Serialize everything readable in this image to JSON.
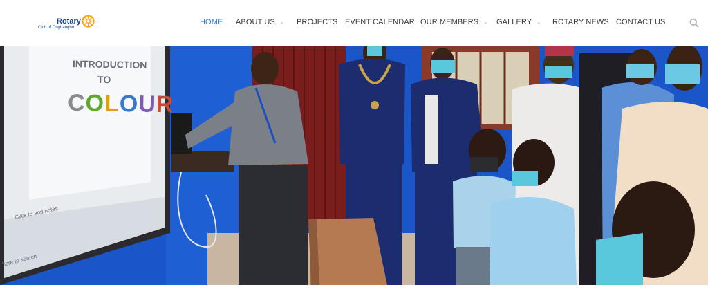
{
  "logo": {
    "word": "Rotary",
    "club": "Club of Ongbangbo",
    "icon": "rotary-wheel-icon",
    "color": "#17458f",
    "wheel_color": "#f7a81b"
  },
  "nav": {
    "items": [
      {
        "label": "HOME",
        "active": true
      },
      {
        "label": "ABOUT US",
        "dropdown": true
      },
      {
        "label": "PROJECTS"
      },
      {
        "label": "EVENT CALENDAR"
      },
      {
        "label": "OUR MEMBERS",
        "dropdown": true
      },
      {
        "label": "GALLERY",
        "dropdown": true
      },
      {
        "label": "ROTARY NEWS"
      },
      {
        "label": "CONTACT US"
      }
    ],
    "active_color": "#2e7fd0",
    "search_icon": "search-icon"
  },
  "hero": {
    "board": {
      "line1": "INTRODUCTION",
      "line2": "TO",
      "colour_letters": [
        "C",
        "O",
        "L",
        "O",
        "U",
        "R"
      ]
    },
    "taskbar_text": "Click to add notes",
    "search_text": "here to search",
    "wall_color": "#1a56c8"
  }
}
